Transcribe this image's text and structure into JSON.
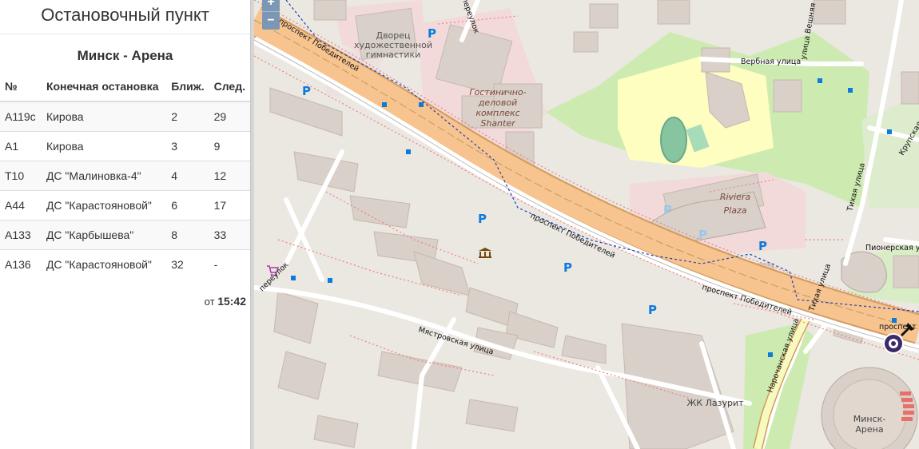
{
  "panel": {
    "header": "Остановочный пункт",
    "stop_name": "Минск - Арена",
    "columns": [
      "№",
      "Конечная остановка",
      "Ближ.",
      "След."
    ],
    "rows": [
      {
        "route": "A119c",
        "terminal": "Кирова",
        "next": "2",
        "after": "29"
      },
      {
        "route": "A1",
        "terminal": "Кирова",
        "next": "3",
        "after": "9"
      },
      {
        "route": "T10",
        "terminal": "ДС \"Малиновка-4\"",
        "next": "4",
        "after": "12"
      },
      {
        "route": "A44",
        "terminal": "ДС \"Карастояновой\"",
        "next": "6",
        "after": "17"
      },
      {
        "route": "A133",
        "terminal": "ДС \"Карбышева\"",
        "next": "8",
        "after": "33"
      },
      {
        "route": "A136",
        "terminal": "ДС \"Карастояновой\"",
        "next": "32",
        "after": "-"
      }
    ],
    "time_prefix": "от",
    "time_value": "15:42"
  },
  "map": {
    "zoom_in": "+",
    "zoom_out": "−",
    "labels": {
      "palace": [
        "Дворец",
        "художественной",
        "гимнастики"
      ],
      "shanter": [
        "Гостинично-",
        "деловой",
        "комплекс",
        "Shanter"
      ],
      "riviera": [
        "Riviera",
        "Plaza"
      ],
      "prospekt": "проспект Победителей",
      "prospekt2": "проспект Победителей",
      "prospekt3": "проспект Победителей",
      "prospekt_short": "проспект Победителей",
      "prospekt_top": "проспект Победителей",
      "verbnaya": "Вербная улица",
      "veshnyaya": "улица Вешняя",
      "tikhaya": "Тихая улица",
      "tikhaya2": "Тихая улица",
      "pionerskaya": "Пионерская улица",
      "krupskaya": "Крупская",
      "narochanskaya": "Нарочанская улица",
      "myastrovskaya": "Мястровская улица",
      "pereulok": "переулок",
      "lazurit": "ЖК Лазурит",
      "arena": [
        "Минск-",
        "Арена"
      ],
      "top_street": "переулок"
    },
    "parking_symbol": "P",
    "colors": {
      "main_road": "#f7c48f",
      "main_road_casing": "#d39b5c",
      "park": "#cdebb0",
      "building": "#d9d0c9",
      "commercial": "#f2dada",
      "school": "#fefec0"
    },
    "icons": [
      "parking-icon",
      "museum-icon",
      "shop-icon",
      "bus-stop-icon",
      "stop-marker-icon",
      "pushpin-icon"
    ]
  }
}
